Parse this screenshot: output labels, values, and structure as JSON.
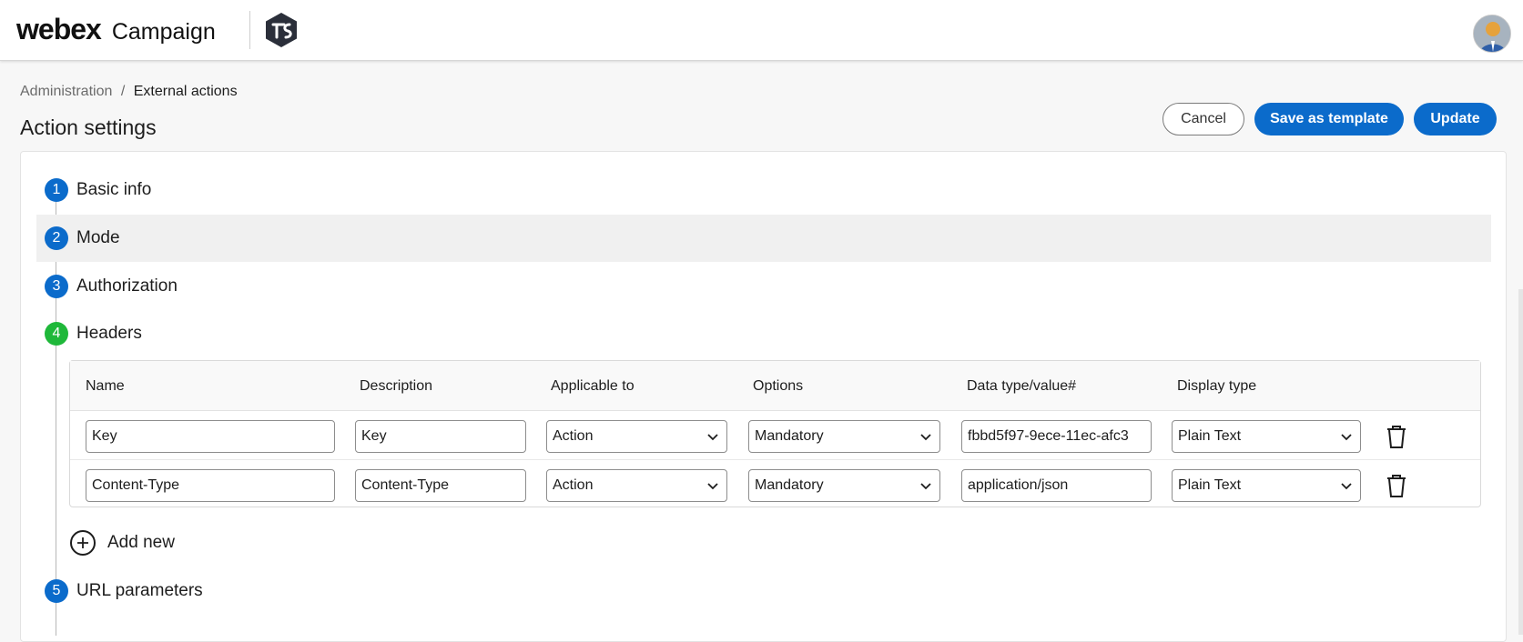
{
  "header": {
    "brand_name": "webex",
    "product_name": "Campaign"
  },
  "breadcrumb": {
    "parent": "Administration",
    "separator": "/",
    "current": "External actions"
  },
  "page": {
    "title": "Action settings"
  },
  "actions": {
    "cancel_label": "Cancel",
    "save_template_label": "Save as template",
    "update_label": "Update",
    "accent_color": "#0b6bcb"
  },
  "steps": [
    {
      "number": "1",
      "label": "Basic info",
      "status": "complete"
    },
    {
      "number": "2",
      "label": "Mode",
      "status": "complete"
    },
    {
      "number": "3",
      "label": "Authorization",
      "status": "complete"
    },
    {
      "number": "4",
      "label": "Headers",
      "status": "current"
    },
    {
      "number": "5",
      "label": "URL parameters",
      "status": "complete"
    }
  ],
  "headers_table": {
    "columns": [
      "Name",
      "Description",
      "Applicable to",
      "Options",
      "Data type/value#",
      "Display type"
    ],
    "rows": [
      {
        "name": "Key",
        "description": "Key",
        "applicable_to": "Action",
        "options": "Mandatory",
        "data_value": "fbbd5f97-9ece-11ec-afc3",
        "display_type": "Plain Text"
      },
      {
        "name": "Content-Type",
        "description": "Content-Type",
        "applicable_to": "Action",
        "options": "Mandatory",
        "data_value": "application/json",
        "display_type": "Plain Text"
      }
    ]
  },
  "add_new": {
    "label": "Add new"
  },
  "icons": {
    "avatar": "user-avatar-icon",
    "logo": "company-logo-icon",
    "delete": "trash-icon",
    "dropdown": "chevron-down-icon",
    "add": "plus-circle-icon"
  }
}
